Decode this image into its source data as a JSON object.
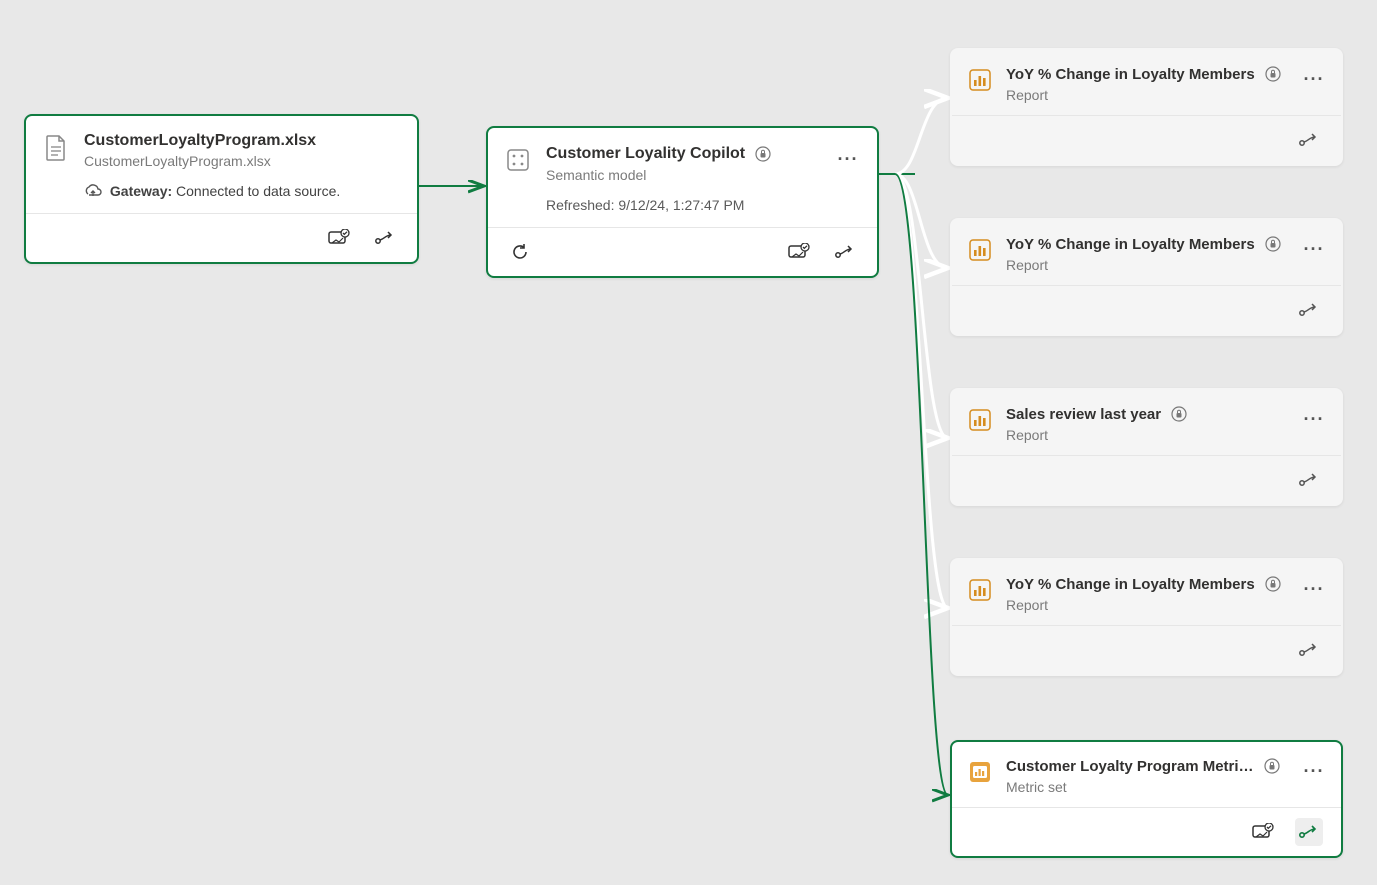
{
  "nodes": {
    "source": {
      "title": "CustomerLoyaltyProgram.xlsx",
      "subtitle": "CustomerLoyaltyProgram.xlsx",
      "gateway_label": "Gateway:",
      "gateway_status": "Connected to data source."
    },
    "model": {
      "title": "Customer Loyality Copilot",
      "type": "Semantic model",
      "refreshed": "Refreshed: 9/12/24, 1:27:47 PM"
    },
    "downstream": [
      {
        "title": "YoY % Change in Loyalty Members",
        "type": "Report",
        "selected": false
      },
      {
        "title": "YoY % Change in Loyalty Members",
        "type": "Report",
        "selected": false
      },
      {
        "title": "Sales review last year",
        "type": "Report",
        "selected": false
      },
      {
        "title": "YoY % Change in Loyalty Members",
        "type": "Report",
        "selected": false
      },
      {
        "title": "Customer Loyalty Program Metri…",
        "type": "Metric set",
        "selected": true
      }
    ]
  },
  "colors": {
    "accent": "#107c41",
    "dim_stroke": "#ffffff"
  }
}
